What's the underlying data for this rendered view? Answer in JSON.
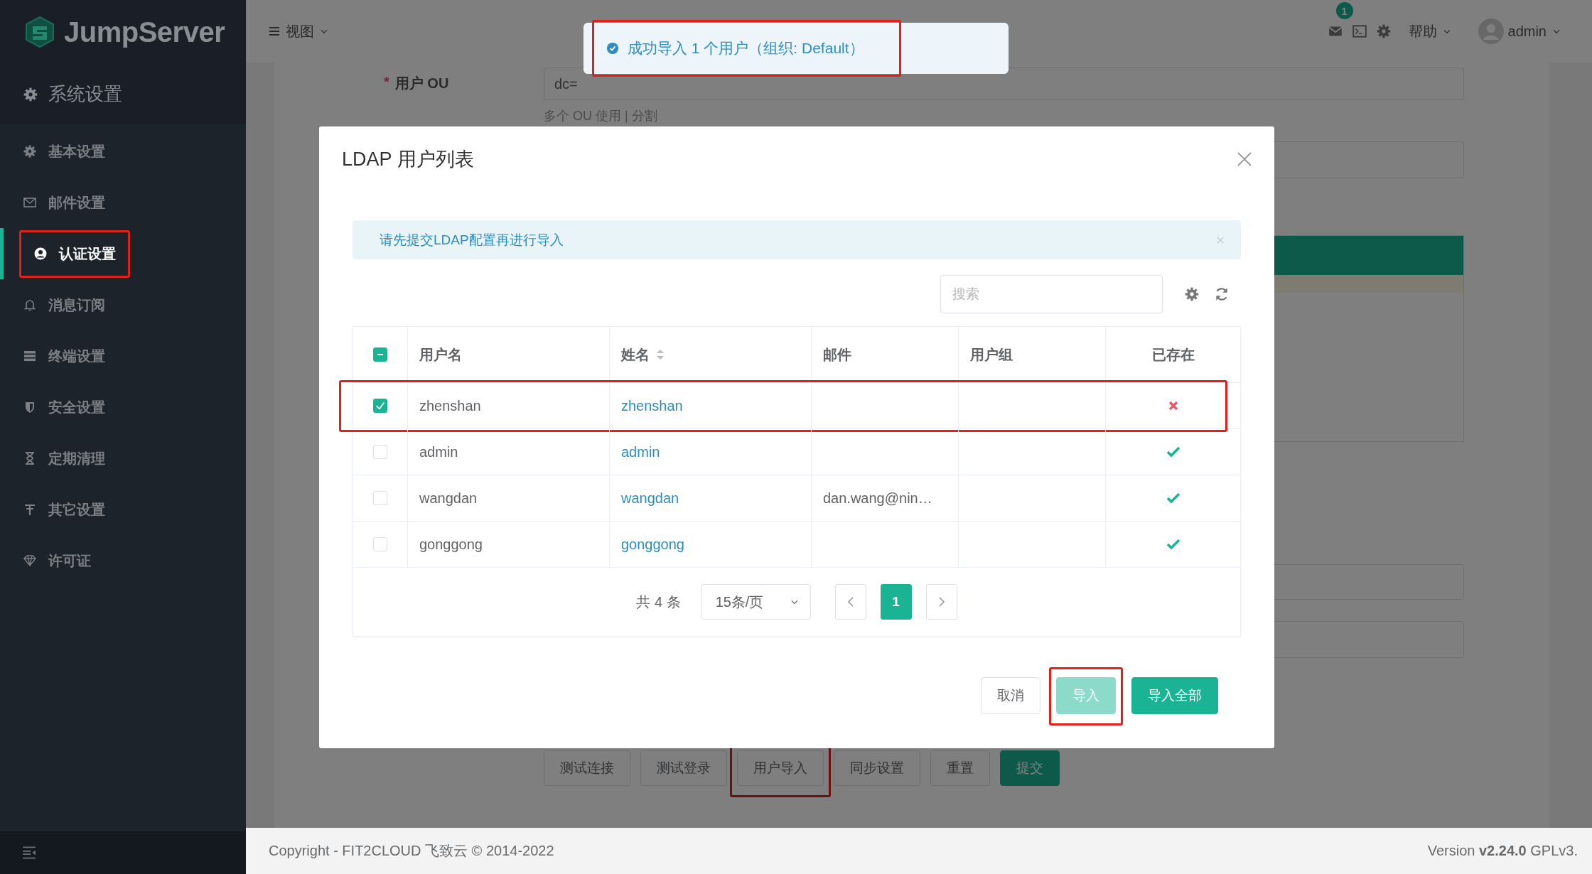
{
  "sidebar": {
    "logo": "JumpServer",
    "section": "系统设置",
    "items": [
      {
        "label": "基本设置",
        "selected": false,
        "annotated": false
      },
      {
        "label": "邮件设置",
        "selected": false,
        "annotated": false
      },
      {
        "label": "认证设置",
        "selected": true,
        "annotated": true
      },
      {
        "label": "消息订阅",
        "selected": false,
        "annotated": false
      },
      {
        "label": "终端设置",
        "selected": false,
        "annotated": false
      },
      {
        "label": "安全设置",
        "selected": false,
        "annotated": false
      },
      {
        "label": "定期清理",
        "selected": false,
        "annotated": false
      },
      {
        "label": "其它设置",
        "selected": false,
        "annotated": false
      },
      {
        "label": "许可证",
        "selected": false,
        "annotated": false
      }
    ]
  },
  "topbar": {
    "view_menu": "视图",
    "mail_badge": "1",
    "help": "帮助",
    "user": "admin"
  },
  "background_form": {
    "required_mark": "*",
    "ou_label": "用户 OU",
    "ou_value": "dc=",
    "ou_hint": "多个 OU 使用 | 分割",
    "buttons": [
      {
        "label": "测试连接",
        "kind": "default",
        "annotated": false
      },
      {
        "label": "测试登录",
        "kind": "default",
        "annotated": false
      },
      {
        "label": "用户导入",
        "kind": "default",
        "annotated": true
      },
      {
        "label": "同步设置",
        "kind": "default",
        "annotated": false
      },
      {
        "label": "重置",
        "kind": "default",
        "annotated": false
      },
      {
        "label": "提交",
        "kind": "primary",
        "annotated": false
      }
    ]
  },
  "toast": {
    "text": "成功导入 1 个用户（组织: Default）",
    "annotated": true
  },
  "dialog": {
    "title": "LDAP 用户列表",
    "alert": "请先提交LDAP配置再进行导入",
    "search": {
      "placeholder": "搜索"
    },
    "table": {
      "indeterminate": true,
      "columns": [
        {
          "label": "用户名",
          "sortable": false
        },
        {
          "label": "姓名",
          "sortable": true
        },
        {
          "label": "邮件",
          "sortable": false
        },
        {
          "label": "用户组",
          "sortable": false
        },
        {
          "label": "已存在",
          "sortable": false
        }
      ],
      "rows": [
        {
          "username": "zhenshan",
          "name": "zhenshan",
          "email": "",
          "exists": false,
          "selected": true,
          "annotated": true
        },
        {
          "username": "admin",
          "name": "admin",
          "email": "",
          "exists": true,
          "selected": false,
          "annotated": false
        },
        {
          "username": "wangdan",
          "name": "wangdan",
          "email": "dan.wang@nin…",
          "exists": true,
          "selected": false,
          "annotated": false
        },
        {
          "username": "gonggong",
          "name": "gonggong",
          "email": "",
          "exists": true,
          "selected": false,
          "annotated": false
        }
      ]
    },
    "pagination": {
      "total": "共 4 条",
      "page_size": "15条/页",
      "pages": [
        {
          "label": "1",
          "selected": true
        }
      ]
    },
    "buttons": [
      {
        "label": "取消",
        "kind": "default",
        "disabled": false,
        "annotated": false
      },
      {
        "label": "导入",
        "kind": "primary",
        "disabled": true,
        "annotated": true
      },
      {
        "label": "导入全部",
        "kind": "primary",
        "disabled": false,
        "annotated": false
      }
    ]
  },
  "footer": {
    "copyright": "Copyright - FIT2CLOUD 飞致云 © 2014-2022",
    "version": "Version **v2.24.0** GPLv3."
  }
}
